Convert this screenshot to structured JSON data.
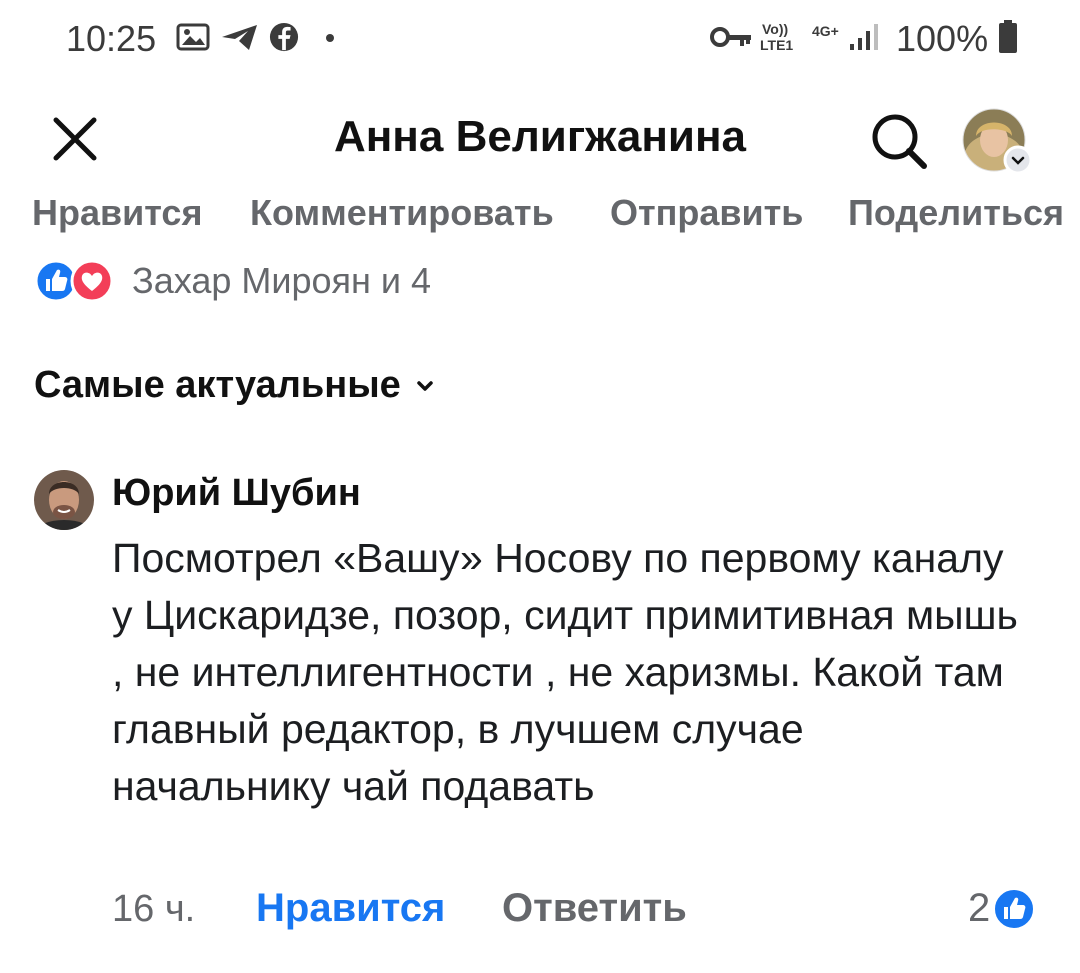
{
  "status_bar": {
    "time": "10:25",
    "lte_top": "Vo))",
    "lte_bottom": "LTE1",
    "net": "4G+",
    "battery": "100%"
  },
  "header": {
    "title": "Анна Велигжанина"
  },
  "actions": {
    "like": "Нравится",
    "comment": "Комментировать",
    "send": "Отправить",
    "share": "Поделиться"
  },
  "reactions": {
    "summary": "Захар Мироян и 4"
  },
  "sort": {
    "label": "Самые актуальные"
  },
  "comment": {
    "author": "Юрий Шубин",
    "text": "Посмотрел «Вашу» Носову по первому каналу у Цискаридзе, позор, сидит примитивная мышь , не интеллигентности , не харизмы. Какой там главный редактор, в лучшем случае начальнику чай подавать",
    "time": "16 ч.",
    "like_label": "Нравится",
    "reply_label": "Ответить",
    "reaction_count": "2"
  },
  "colors": {
    "accent": "#1877f2",
    "muted": "#65676b",
    "love": "#f33e58"
  },
  "icons": [
    "image-icon",
    "telegram-icon",
    "facebook-icon",
    "key-icon",
    "signal-icon",
    "battery-icon",
    "close-icon",
    "search-icon",
    "chevron-down-icon",
    "like-reaction-icon",
    "love-reaction-icon"
  ]
}
